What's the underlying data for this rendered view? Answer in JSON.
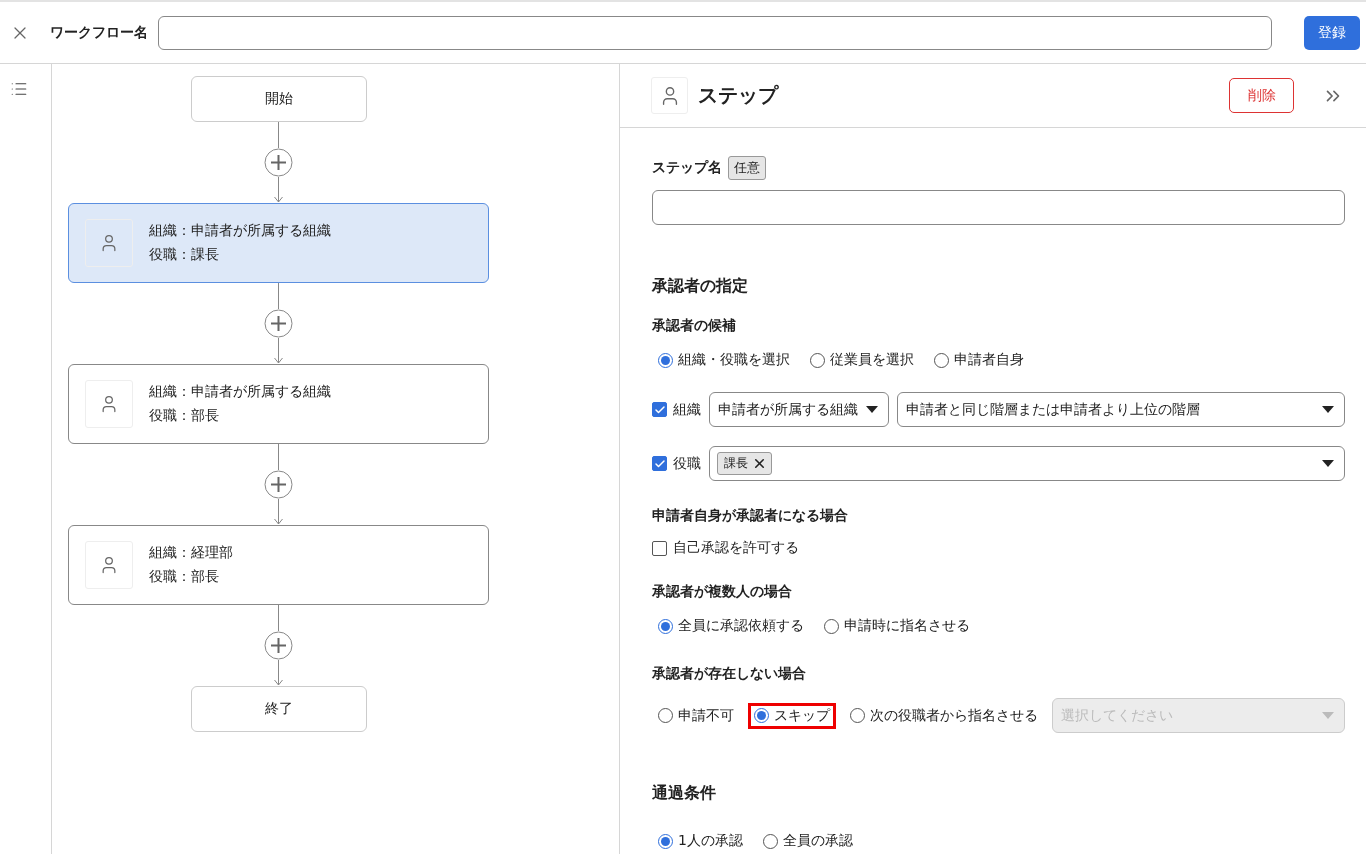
{
  "header": {
    "name_label": "ワークフロー名",
    "submit_button": "登録"
  },
  "flow": {
    "nodes": [
      {
        "kind": "terminal",
        "label": "開始"
      },
      {
        "kind": "step",
        "selected": true,
        "lines": [
          "組織：申請者が所属する組織",
          "役職：課長"
        ]
      },
      {
        "kind": "step",
        "selected": false,
        "lines": [
          "組織：申請者が所属する組織",
          "役職：部長"
        ]
      },
      {
        "kind": "step",
        "selected": false,
        "lines": [
          "組織：経理部",
          "役職：部長"
        ]
      },
      {
        "kind": "terminal",
        "label": "終了"
      }
    ]
  },
  "panel": {
    "title": "ステップ",
    "delete_button": "削除",
    "step_name": {
      "label": "ステップ名",
      "badge": "任意"
    },
    "blocks": [
      {
        "kind": "heading",
        "text": "承認者の指定"
      },
      {
        "kind": "subheading",
        "text": "承認者の候補"
      },
      {
        "kind": "radios",
        "options": [
          {
            "label": "組織・役職を選択",
            "selected": true
          },
          {
            "label": "従業員を選択",
            "selected": false
          },
          {
            "label": "申請者自身",
            "selected": false
          }
        ]
      },
      {
        "kind": "selects",
        "label": "組織",
        "checked": true,
        "selects": [
          "申請者が所属する組織",
          "申請者と同じ階層または申請者より上位の階層"
        ]
      },
      {
        "kind": "tags",
        "label": "役職",
        "checked": true,
        "tags": [
          "課長"
        ]
      },
      {
        "kind": "subheading",
        "text": "申請者自身が承認者になる場合"
      },
      {
        "kind": "checkbox",
        "label": "自己承認を許可する",
        "checked": false
      },
      {
        "kind": "subheading",
        "text": "承認者が複数人の場合"
      },
      {
        "kind": "radios",
        "options": [
          {
            "label": "全員に承認依頼する",
            "selected": true
          },
          {
            "label": "申請時に指名させる",
            "selected": false
          }
        ]
      },
      {
        "kind": "subheading",
        "text": "承認者が存在しない場合"
      },
      {
        "kind": "radios",
        "options": [
          {
            "label": "申請不可",
            "selected": false
          },
          {
            "label": "スキップ",
            "selected": true,
            "highlighted": true
          },
          {
            "label": "次の役職者から指名させる",
            "selected": false
          }
        ],
        "select": {
          "placeholder": "選択してください",
          "disabled": true
        }
      },
      {
        "kind": "heading",
        "text": "通過条件"
      },
      {
        "kind": "radios",
        "options": [
          {
            "label": "1人の承認",
            "selected": true
          },
          {
            "label": "全員の承認",
            "selected": false
          }
        ]
      }
    ]
  }
}
